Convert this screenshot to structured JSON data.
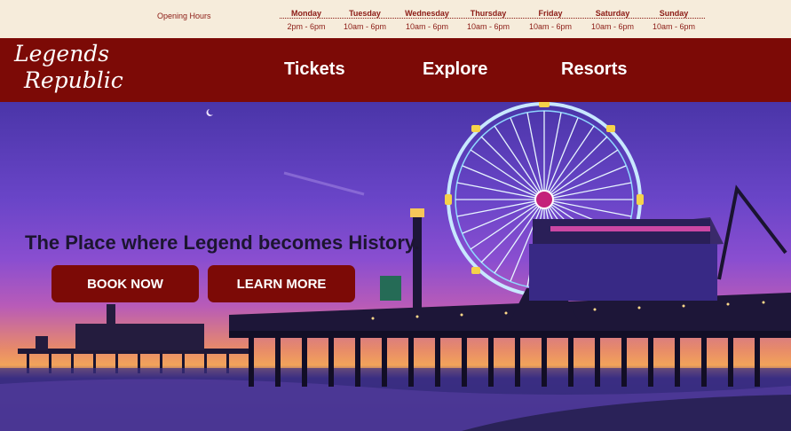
{
  "hours": {
    "label": "Opening Hours",
    "days": [
      {
        "name": "Monday",
        "time": "2pm - 6pm"
      },
      {
        "name": "Tuesday",
        "time": "10am - 6pm"
      },
      {
        "name": "Wednesday",
        "time": "10am - 6pm"
      },
      {
        "name": "Thursday",
        "time": "10am - 6pm"
      },
      {
        "name": "Friday",
        "time": "10am - 6pm"
      },
      {
        "name": "Saturday",
        "time": "10am - 6pm"
      },
      {
        "name": "Sunday",
        "time": "10am - 6pm"
      }
    ]
  },
  "nav": {
    "logo_line1": "Legends",
    "logo_line2": "Republic",
    "links": [
      "Tickets",
      "Explore",
      "Resorts"
    ]
  },
  "hero": {
    "headline": "The Place where Legend becomes History.",
    "primary_button": "BOOK NOW",
    "secondary_button": "LEARN MORE"
  },
  "colors": {
    "brand": "#7c0a06",
    "cream": "#f6ecdb"
  }
}
